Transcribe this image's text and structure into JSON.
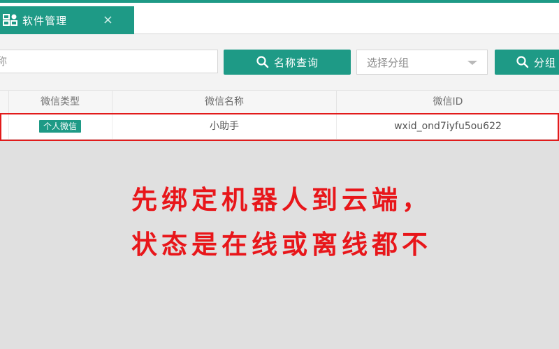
{
  "tab": {
    "label": "软件管理",
    "close": "×",
    "icon": "app-grid-icon"
  },
  "toolbar": {
    "search_placeholder_visible": "称",
    "name_query_button": "名称查询",
    "group_select_value": "选择分组",
    "group_query_button_visible": "分组"
  },
  "table": {
    "headers": [
      "微信类型",
      "微信名称",
      "微信ID"
    ],
    "rows": [
      {
        "type": "个人微信",
        "name": "小助手",
        "wxid": "wxid_ond7iyfu5ou622"
      }
    ]
  },
  "annotation": {
    "line1": "先绑定机器人到云端，",
    "line2": "状态是在线或离线都不"
  },
  "colors": {
    "accent": "#1e9a86",
    "highlight": "#e21b1b"
  }
}
